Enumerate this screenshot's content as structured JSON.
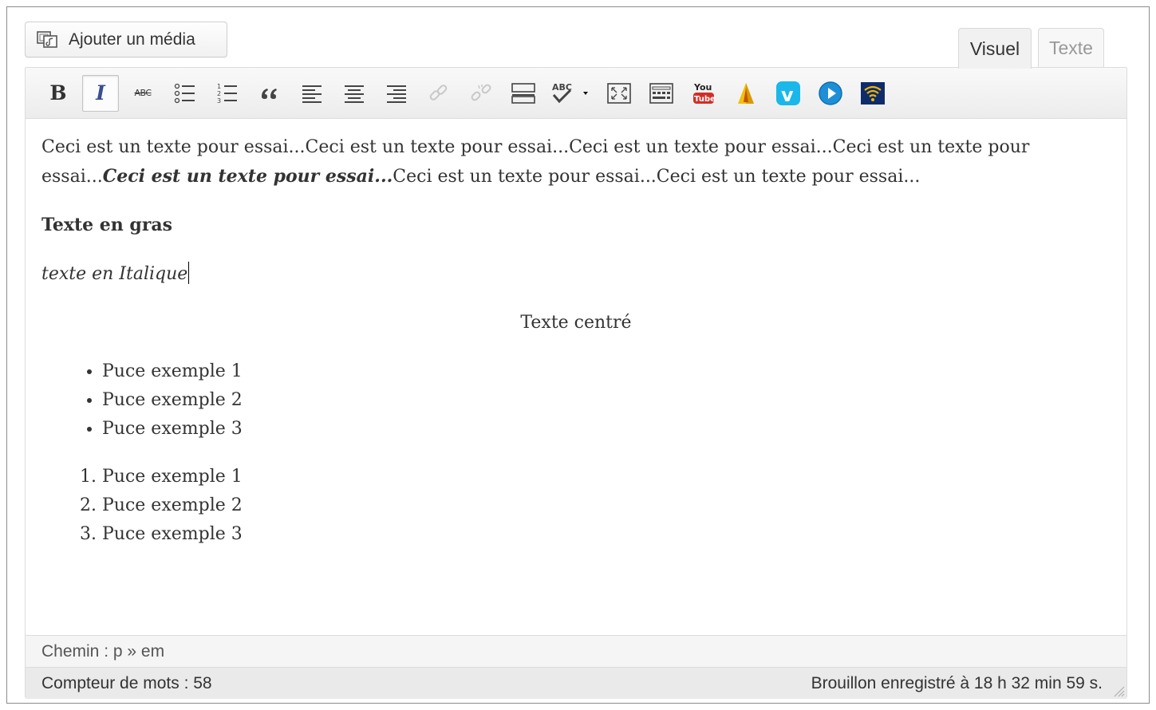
{
  "media_button": {
    "label": "Ajouter un média"
  },
  "tabs": {
    "visual": "Visuel",
    "text": "Texte"
  },
  "toolbar": {
    "bold": "B",
    "italic": "I",
    "strike": "ABC",
    "spell": "ABC",
    "youtube_top": "You",
    "youtube_bottom": "Tube",
    "vimeo": "v"
  },
  "content": {
    "para1_a": "Ceci est un texte pour essai...Ceci est un texte pour essai...Ceci est un texte pour essai...Ceci est un texte pour essai...",
    "para1_b": "Ceci est un texte pour essai...",
    "para1_c": "Ceci est un texte pour essai...Ceci est un texte pour essai...",
    "bold_text": "Texte en gras",
    "italic_text": "texte en Italique",
    "centered_text": "Texte centré",
    "bullets": [
      "Puce exemple 1",
      "Puce exemple 2",
      "Puce exemple 3"
    ],
    "numbered": [
      "Puce exemple 1",
      "Puce exemple 2",
      "Puce exemple 3"
    ]
  },
  "path_bar": {
    "text": "Chemin : p » em"
  },
  "status_bar": {
    "word_count": "Compteur de mots : 58",
    "draft_saved": "Brouillon enregistré à 18 h 32 min 59 s."
  },
  "colors": {
    "vimeo": "#1ab7ea",
    "youtube_red": "#d42d27",
    "blue_circle": "#1e8fd6",
    "italic_active": "#3a4f8f"
  }
}
